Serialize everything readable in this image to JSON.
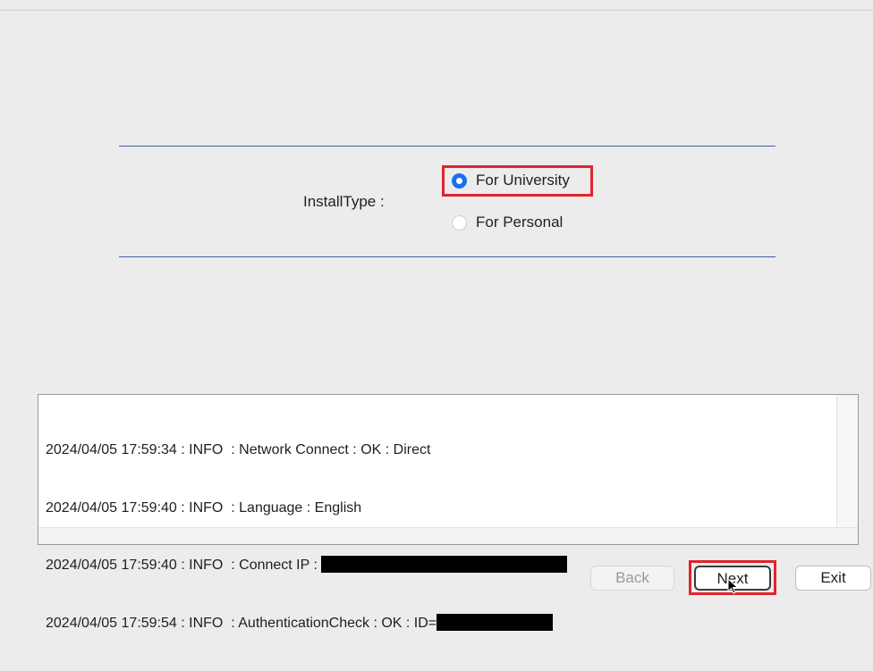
{
  "install": {
    "label": "InstallType :",
    "options": [
      {
        "label": "For University",
        "selected": true
      },
      {
        "label": "For Personal",
        "selected": false
      }
    ]
  },
  "log": {
    "lines": [
      {
        "text": "2024/04/05 17:59:34 : INFO  : Network Connect : OK : Direct",
        "redacted": false
      },
      {
        "text": "2024/04/05 17:59:40 : INFO  : Language : English",
        "redacted": false
      },
      {
        "text": "2024/04/05 17:59:40 : INFO  : Connect IP : ",
        "redacted": true
      },
      {
        "text": "2024/04/05 17:59:54 : INFO  : AuthenticationCheck : OK : ID=",
        "redacted": true
      }
    ]
  },
  "buttons": {
    "back": "Back",
    "next": "Next",
    "exit": "Exit"
  },
  "colors": {
    "accent": "#1a6ff0",
    "highlight": "#e0242d",
    "divider": "#3b5fa6"
  }
}
